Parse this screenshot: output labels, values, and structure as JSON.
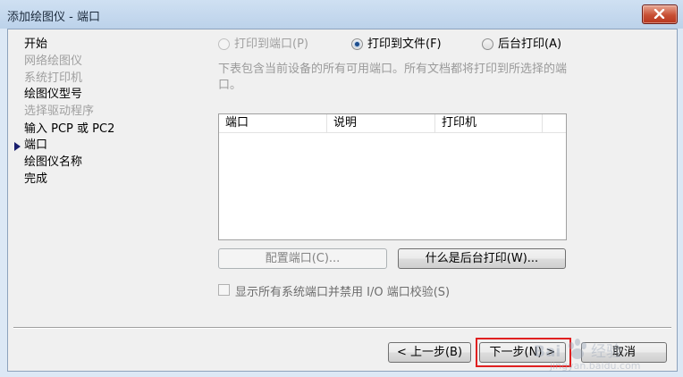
{
  "window": {
    "title": "添加绘图仪 - 端口"
  },
  "steps": [
    {
      "label": "开始",
      "state": "enabled"
    },
    {
      "label": "网络绘图仪",
      "state": "disabled"
    },
    {
      "label": "系统打印机",
      "state": "disabled"
    },
    {
      "label": "绘图仪型号",
      "state": "enabled"
    },
    {
      "label": "选择驱动程序",
      "state": "disabled"
    },
    {
      "label": "输入 PCP 或 PC2",
      "state": "enabled"
    },
    {
      "label": "端口",
      "state": "current"
    },
    {
      "label": "绘图仪名称",
      "state": "enabled"
    },
    {
      "label": "完成",
      "state": "enabled"
    }
  ],
  "output_options": [
    {
      "label": "打印到端口(P)",
      "checked": false,
      "enabled": false
    },
    {
      "label": "打印到文件(F)",
      "checked": true,
      "enabled": true
    },
    {
      "label": "后台打印(A)",
      "checked": false,
      "enabled": true
    }
  ],
  "description": "下表包含当前设备的所有可用端口。所有文档都将打印到所选择的端口。",
  "port_table": {
    "columns": [
      "端口",
      "说明",
      "打印机"
    ],
    "rows": []
  },
  "buttons": {
    "configure_port": "配置端口(C)...",
    "what_is_autospool": "什么是后台打印(W)...",
    "back": "< 上一步(B)",
    "next": "下一步(N) >",
    "cancel": "取消"
  },
  "checkbox": {
    "label": "显示所有系统端口并禁用 I/O 端口校验(S)",
    "checked": false
  },
  "watermark": {
    "text": "Baidu 经验",
    "url_text": "jingyan.baidu.com"
  },
  "colors": {
    "accent_highlight": "#e02020",
    "title_bar": "#bcd2ea",
    "close_button": "#c74f34"
  }
}
